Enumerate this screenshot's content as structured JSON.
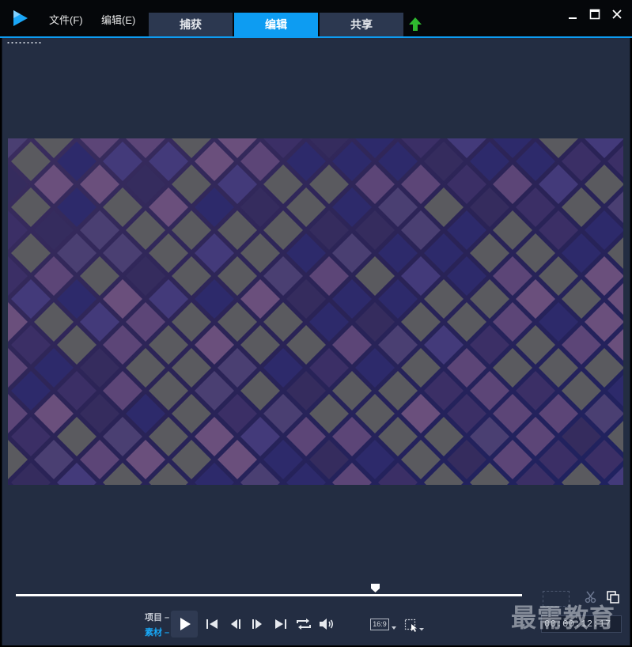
{
  "menu": {
    "file": "文件(F)",
    "edit": "编辑(E)"
  },
  "tabs": [
    {
      "label": "捕获",
      "active": false
    },
    {
      "label": "编辑",
      "active": true
    },
    {
      "label": "共享",
      "active": false
    }
  ],
  "icons": {
    "logo": "app-logo-play",
    "upload": "upload-arrow-icon",
    "minimize": "minimize-icon",
    "maximize": "maximize-icon",
    "close": "close-icon",
    "play": "play-icon",
    "home": "skip-to-start-icon",
    "prev": "previous-frame-icon",
    "next": "next-frame-icon",
    "end": "skip-to-end-icon",
    "repeat": "repeat-icon",
    "volume": "volume-icon",
    "scissors": "scissors-icon",
    "copy": "copy-icon",
    "select": "selection-icon"
  },
  "colors": {
    "accent": "#0d9cf2",
    "body_bg": "#232d42",
    "upload_green": "#2fb82f",
    "clip_label": "#18a7f5"
  },
  "player": {
    "mode_project": "项目",
    "mode_clip": "素材",
    "aspect_ratio": "16:9",
    "scrub_position": 0.71,
    "timecode": "00:00:12:17"
  },
  "watermark": "最需教育"
}
